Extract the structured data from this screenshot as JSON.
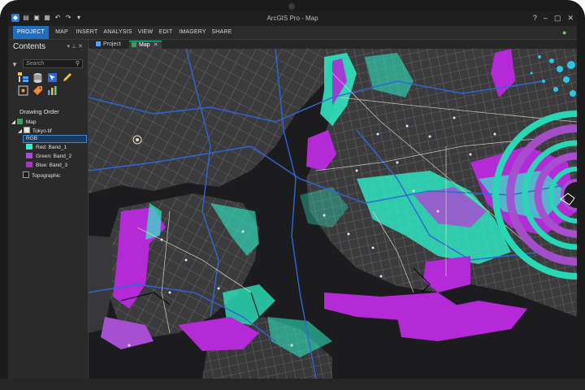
{
  "window": {
    "title": "ArcGIS Pro - Map",
    "controls": [
      "?",
      "–",
      "▢",
      "✕"
    ]
  },
  "ribbon": {
    "tabs": [
      {
        "label": "PROJECT",
        "active": true
      },
      {
        "label": "MAP"
      },
      {
        "label": "INSERT"
      },
      {
        "label": "ANALYSIS"
      },
      {
        "label": "VIEW"
      },
      {
        "label": "EDIT"
      },
      {
        "label": "IMAGERY"
      },
      {
        "label": "SHARE"
      }
    ],
    "signin_icon": "user-icon"
  },
  "contents": {
    "title": "Contents",
    "search_placeholder": "Search",
    "section": "Drawing Order",
    "tree": {
      "map": "Map",
      "layer": "Tokyo.tif",
      "rgb": "RGB",
      "bands": [
        {
          "label": "Red:  Band_1",
          "color": "#2ef0c8"
        },
        {
          "label": "Green: Band_2",
          "color": "#a64fd0"
        },
        {
          "label": "Blue: Band_3",
          "color": "#b32ad6"
        }
      ],
      "basemap": "Topographic"
    }
  },
  "views": {
    "tabs": [
      {
        "label": "Project"
      },
      {
        "label": "Map",
        "active": true
      }
    ]
  },
  "colors": {
    "accent_blue": "#1e6fbf",
    "flood_cyan": "#2ef0c8",
    "flood_magenta": "#b32ad6",
    "water": "#1b1b1d",
    "land": "#3a3a3c",
    "roads": "#d9d2bd",
    "highways": "#2f66d8"
  }
}
